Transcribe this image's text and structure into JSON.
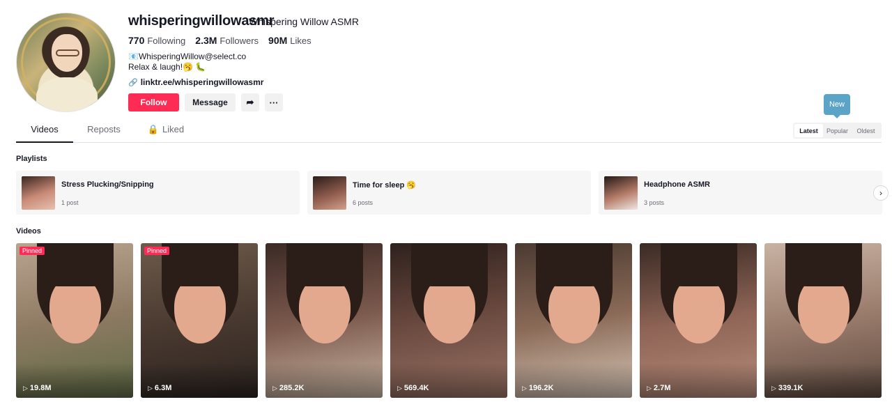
{
  "profile": {
    "username": "whisperingwillowasmr",
    "nickname": "Whispering Willow ASMR",
    "stats": [
      {
        "value": "770",
        "label": "Following"
      },
      {
        "value": "2.3M",
        "label": "Followers"
      },
      {
        "value": "90M",
        "label": "Likes"
      }
    ],
    "bio_line1": "📧WhisperingWillow@select.co",
    "bio_line2": "Relax & laugh!🥱 🐛",
    "link": "linktr.ee/whisperingwillowasmr"
  },
  "actions": {
    "follow": "Follow",
    "message": "Message"
  },
  "tabs": {
    "videos": "Videos",
    "reposts": "Reposts",
    "liked": "Liked"
  },
  "sort": {
    "tooltip": "New",
    "options": [
      "Latest",
      "Popular",
      "Oldest"
    ]
  },
  "playlists_title": "Playlists",
  "playlists": [
    {
      "name": "Stress Plucking/Snipping",
      "count": "1 post"
    },
    {
      "name": "Time for sleep 🥱",
      "count": "6 posts"
    },
    {
      "name": "Headphone ASMR",
      "count": "3 posts"
    }
  ],
  "videos_title": "Videos",
  "pinned_label": "Pinned",
  "videos": [
    {
      "views": "19.8M"
    },
    {
      "views": "6.3M"
    },
    {
      "views": "285.2K"
    },
    {
      "views": "569.4K"
    },
    {
      "views": "196.2K"
    },
    {
      "views": "2.7M"
    },
    {
      "views": "339.1K"
    }
  ],
  "colors": {
    "accent": "#fe2c55",
    "tooltip": "#5ba3c7"
  }
}
